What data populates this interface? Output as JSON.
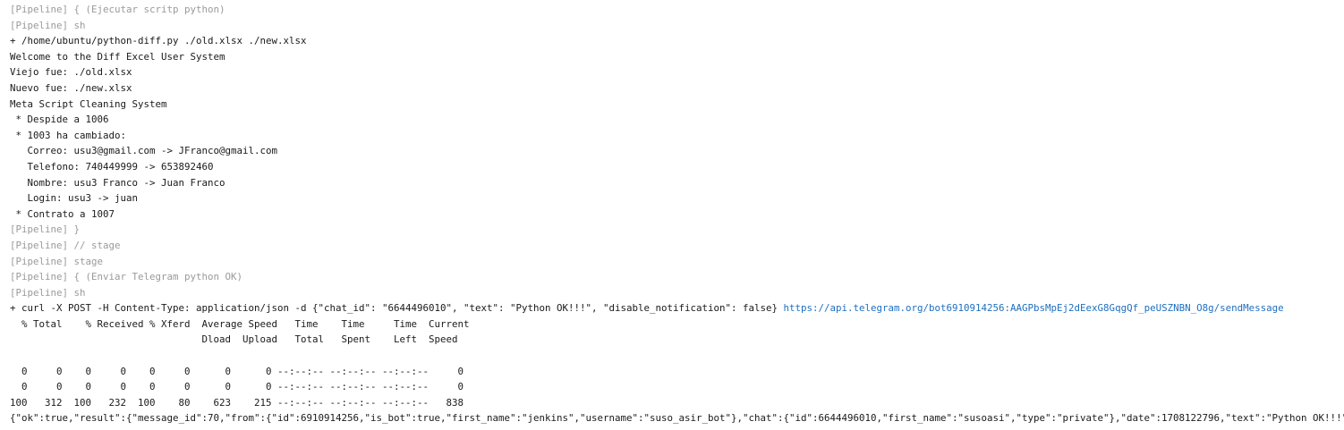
{
  "console": {
    "lines": [
      {
        "kind": "pipeline",
        "text": "[Pipeline] { (Ejecutar scritp python)"
      },
      {
        "kind": "pipeline",
        "text": "[Pipeline] sh"
      },
      {
        "kind": "output",
        "text": "+ /home/ubuntu/python-diff.py ./old.xlsx ./new.xlsx"
      },
      {
        "kind": "output",
        "text": "Welcome to the Diff Excel User System"
      },
      {
        "kind": "output",
        "text": "Viejo fue: ./old.xlsx"
      },
      {
        "kind": "output",
        "text": "Nuevo fue: ./new.xlsx"
      },
      {
        "kind": "output",
        "text": "Meta Script Cleaning System"
      },
      {
        "kind": "output",
        "text": " * Despide a 1006"
      },
      {
        "kind": "output",
        "text": " * 1003 ha cambiado:"
      },
      {
        "kind": "output",
        "text": "   Correo: usu3@gmail.com -> JFranco@gmail.com"
      },
      {
        "kind": "output",
        "text": "   Telefono: 740449999 -> 653892460"
      },
      {
        "kind": "output",
        "text": "   Nombre: usu3 Franco -> Juan Franco"
      },
      {
        "kind": "output",
        "text": "   Login: usu3 -> juan"
      },
      {
        "kind": "output",
        "text": " * Contrato a 1007"
      },
      {
        "kind": "pipeline",
        "text": "[Pipeline] }"
      },
      {
        "kind": "pipeline",
        "text": "[Pipeline] // stage"
      },
      {
        "kind": "pipeline",
        "text": "[Pipeline] stage"
      },
      {
        "kind": "pipeline",
        "text": "[Pipeline] { (Enviar Telegram python OK)"
      },
      {
        "kind": "pipeline",
        "text": "[Pipeline] sh"
      },
      {
        "kind": "command",
        "text": "+ curl -X POST -H Content-Type: application/json -d {\"chat_id\": \"6644496010\", \"text\": \"Python OK!!!\", \"disable_notification\": false} ",
        "link": "https://api.telegram.org/bot6910914256:AAGPbsMpEj2dEexG8GqgQf_peUSZNBN_O8g/sendMessage"
      },
      {
        "kind": "output",
        "text": "  % Total    % Received % Xferd  Average Speed   Time    Time     Time  Current"
      },
      {
        "kind": "output",
        "text": "                                 Dload  Upload   Total   Spent    Left  Speed"
      },
      {
        "kind": "blank",
        "text": ""
      },
      {
        "kind": "output",
        "text": "  0     0    0     0    0     0      0      0 --:--:-- --:--:-- --:--:--     0"
      },
      {
        "kind": "output",
        "text": "  0     0    0     0    0     0      0      0 --:--:-- --:--:-- --:--:--     0"
      },
      {
        "kind": "output",
        "text": "100   312  100   232  100    80    623    215 --:--:-- --:--:-- --:--:--   838"
      },
      {
        "kind": "output",
        "text": "{\"ok\":true,\"result\":{\"message_id\":70,\"from\":{\"id\":6910914256,\"is_bot\":true,\"first_name\":\"jenkins\",\"username\":\"suso_asir_bot\"},\"chat\":{\"id\":6644496010,\"first_name\":\"susoasi\",\"type\":\"private\"},\"date\":1708122796,\"text\":\"Python OK!!!\"}}"
      }
    ]
  }
}
